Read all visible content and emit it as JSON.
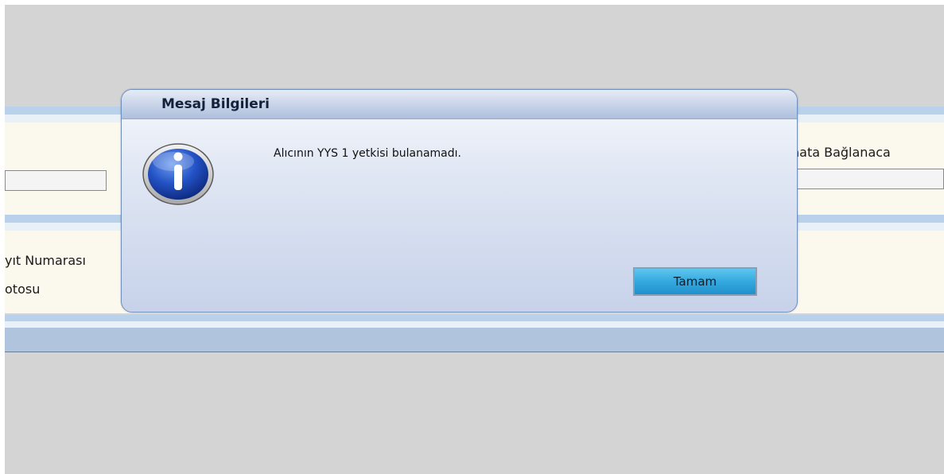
{
  "background": {
    "label_right_top": "nata Bağlanaca",
    "label_left_1": "yıt Numarası",
    "label_left_2": "otosu"
  },
  "dialog": {
    "title": "Mesaj Bilgileri",
    "icon": "info-icon",
    "message": "Alıcının YYS 1 yetkisi bulanamadı.",
    "ok_label": "Tamam"
  },
  "colors": {
    "accent_button": "#34a9df",
    "dialog_border": "#6f8fbf",
    "stripe": "#b9d1ea"
  }
}
